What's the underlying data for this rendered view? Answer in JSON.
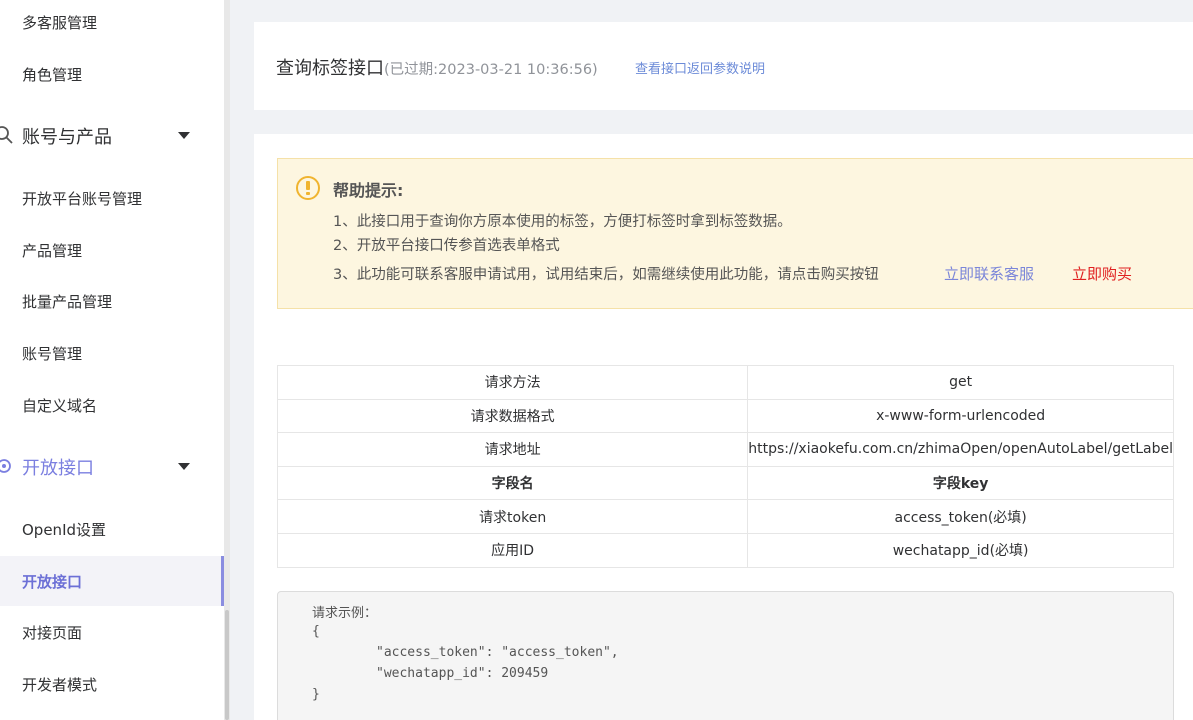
{
  "sidebar": {
    "items": [
      {
        "label": "多客服管理"
      },
      {
        "label": "角色管理"
      },
      {
        "label": "账号与产品",
        "type": "group"
      },
      {
        "label": "开放平台账号管理"
      },
      {
        "label": "产品管理"
      },
      {
        "label": "批量产品管理"
      },
      {
        "label": "账号管理"
      },
      {
        "label": "自定义域名"
      },
      {
        "label": "开放接口",
        "type": "group"
      },
      {
        "label": "OpenId设置"
      },
      {
        "label": "开放接口",
        "active": true
      },
      {
        "label": "对接页面"
      },
      {
        "label": "开发者模式"
      }
    ]
  },
  "header": {
    "title": "查询标签接口",
    "expire": "(已过期:2023-03-21 10:36:56)",
    "doc_link": "查看接口返回参数说明"
  },
  "help": {
    "title": "帮助提示:",
    "lines": [
      "1、此接口用于查询你方原本使用的标签，方便打标签时拿到标签数据。",
      "2、开放平台接口传参首选表单格式",
      "3、此功能可联系客服申请试用，试用结束后，如需继续使用此功能，请点击购买按钮"
    ],
    "contact_link": "立即联系客服",
    "buy_link": "立即购买"
  },
  "params_table": {
    "rows": [
      [
        "请求方法",
        "get"
      ],
      [
        "请求数据格式",
        "x-www-form-urlencoded"
      ],
      [
        "请求地址",
        "https://xiaokefu.com.cn/zhimaOpen/openAutoLabel/getLabel"
      ],
      [
        "字段名",
        "字段key"
      ],
      [
        "请求token",
        "access_token(必填)"
      ],
      [
        "应用ID",
        "wechatapp_id(必填)"
      ]
    ]
  },
  "example": {
    "lines": [
      "请求示例：",
      "{",
      "\"access_token\": \"access_token\",",
      "\"wechatapp_id\": 209459",
      "}"
    ]
  },
  "colors": {
    "accent": "#7b7fe0",
    "link": "#6c8bd8",
    "buy": "#e02020",
    "help_bg": "#fdf6e0",
    "warning_icon": "#f0b42f"
  }
}
